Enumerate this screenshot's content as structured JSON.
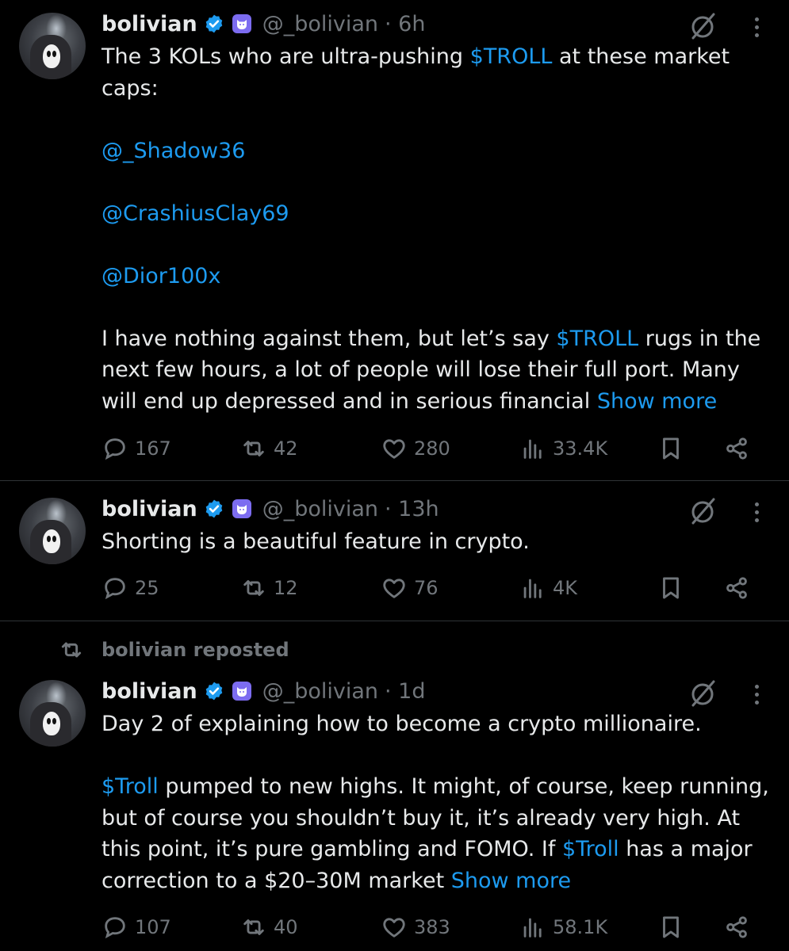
{
  "tweets": [
    {
      "name": "bolivian",
      "handle": "@_bolivian",
      "time": "· 6h",
      "paragraphs": [
        [
          {
            "t": "The 3 KOLs who are ultra-pushing "
          },
          {
            "t": "$TROLL",
            "link": true
          },
          {
            "t": " at these market caps:"
          }
        ],
        [
          {
            "t": "@_Shadow36",
            "link": true
          }
        ],
        [
          {
            "t": "@CrashiusClay69",
            "link": true
          }
        ],
        [
          {
            "t": "@Dior100x",
            "link": true
          }
        ],
        [
          {
            "t": "I have nothing against them, but let’s say "
          },
          {
            "t": "$TROLL",
            "link": true
          },
          {
            "t": " rugs in the next few hours, a lot of people will lose their full port. Many will end up depressed and in serious financial "
          },
          {
            "t": "Show more",
            "link": true
          }
        ]
      ],
      "replies": "167",
      "reposts": "42",
      "likes": "280",
      "views": "33.4K"
    },
    {
      "name": "bolivian",
      "handle": "@_bolivian",
      "time": "· 13h",
      "paragraphs": [
        [
          {
            "t": "Shorting is a beautiful feature in crypto."
          }
        ]
      ],
      "replies": "25",
      "reposts": "12",
      "likes": "76",
      "views": "4K"
    },
    {
      "name": "bolivian",
      "handle": "@_bolivian",
      "time": "· 1d",
      "paragraphs": [
        [
          {
            "t": "Day 2 of explaining how to become a crypto millionaire."
          }
        ],
        [
          {
            "t": "$Troll",
            "link": true
          },
          {
            "t": " pumped to new highs. It might, of course, keep running, but of course you shouldn’t buy it, it’s already very high. At this point, it’s pure gambling and FOMO. If "
          },
          {
            "t": "$Troll",
            "link": true
          },
          {
            "t": " has a major correction to a $20–30M market "
          },
          {
            "t": "Show more",
            "link": true
          }
        ]
      ],
      "replies": "107",
      "reposts": "40",
      "likes": "383",
      "views": "58.1K"
    }
  ],
  "repost_label": "bolivian reposted",
  "colors": {
    "background": "#000000",
    "text": "#e7e9ea",
    "muted": "#71767b",
    "link": "#1d9bf0",
    "divider": "#2f3336",
    "verified": "#1d9bf0",
    "badge": "#7c6cf0"
  },
  "icons": {
    "reply": "speech-bubble-icon",
    "repost": "repost-arrows-icon",
    "like": "heart-icon",
    "views": "bar-chart-icon",
    "bookmark": "bookmark-icon",
    "share": "share-icon",
    "grok": "grok-slash-circle-icon",
    "more": "vertical-dots-icon",
    "verified": "verified-check-icon",
    "affiliate": "cat-face-badge-icon"
  }
}
